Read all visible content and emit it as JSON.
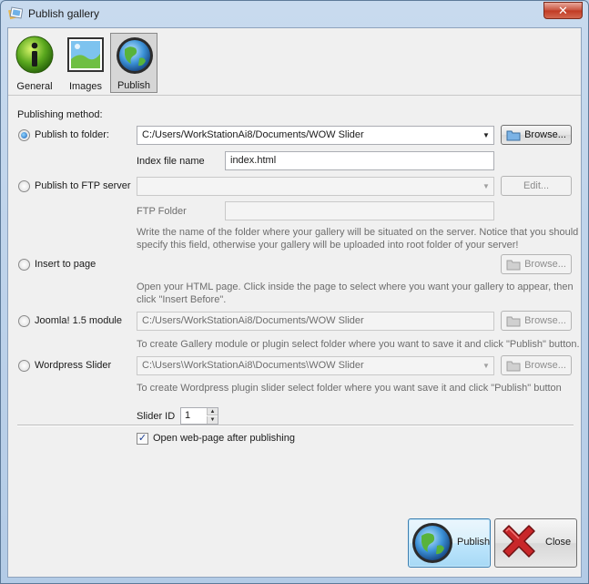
{
  "window": {
    "title": "Publish gallery",
    "close_glyph": "✕"
  },
  "tabs": [
    {
      "label": "General",
      "icon": "info-icon"
    },
    {
      "label": "Images",
      "icon": "image-icon"
    },
    {
      "label": "Publish",
      "icon": "globe-icon",
      "active": true
    }
  ],
  "publishing": {
    "section_label": "Publishing method:",
    "folder": {
      "label": "Publish to folder:",
      "path": "C:/Users/WorkStationAi8/Documents/WOW Slider",
      "browse": "Browse...",
      "index_label": "Index file name",
      "index_value": "index.html"
    },
    "ftp": {
      "label": "Publish to FTP server",
      "server_value": "",
      "edit": "Edit...",
      "folder_label": "FTP Folder",
      "folder_value": "",
      "hint": "Write the name of the folder where your gallery will be situated on the server. Notice that you should specify this field, otherwise your gallery will be uploaded into root folder of your server!"
    },
    "insert": {
      "label": "Insert to page",
      "browse": "Browse...",
      "hint": "Open your HTML page. Click inside the page to select where you want your gallery to appear, then click \"Insert Before\"."
    },
    "joomla": {
      "label": "Joomla! 1.5 module",
      "path": "C:/Users/WorkStationAi8/Documents/WOW Slider",
      "browse": "Browse...",
      "hint": "To create Gallery module or plugin select folder where you want to save it and click \"Publish\" button."
    },
    "wordpress": {
      "label": "Wordpress Slider",
      "path": "C:\\Users\\WorkStationAi8\\Documents\\WOW Slider",
      "browse": "Browse...",
      "hint": "To create Wordpress plugin slider select folder where you want save it and click \"Publish\" button"
    }
  },
  "slider": {
    "id_label": "Slider ID",
    "id_value": "1"
  },
  "open_after": {
    "label": "Open web-page after publishing",
    "checked": true
  },
  "actions": {
    "publish": "Publish",
    "close": "Close"
  },
  "colors": {
    "accent": "#1b5fb8",
    "close_red": "#c8272a"
  }
}
